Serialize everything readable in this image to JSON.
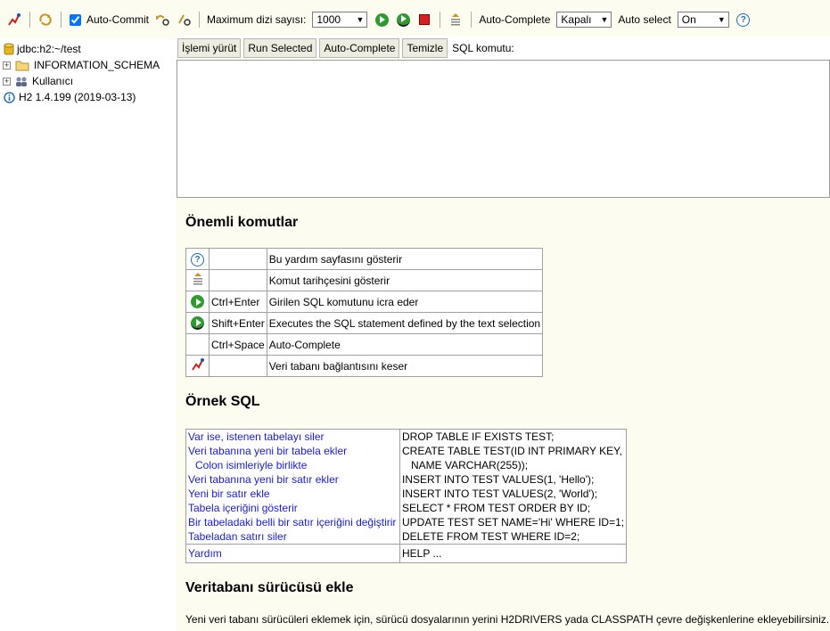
{
  "toolbar": {
    "disconnect_icon": "disconnect-icon",
    "refresh_icon": "refresh-icon",
    "auto_commit_label": "Auto-Commit",
    "auto_commit_checked": true,
    "rollback_icon": "rollback-icon",
    "commit_icon": "commit-icon",
    "max_rows_label": "Maximum dizi sayısı:",
    "max_rows_value": "1000",
    "run_icon": "run-icon",
    "run_selected_icon": "run-selected-icon",
    "stop_icon": "stop-icon",
    "history_icon": "history-icon",
    "auto_complete_label": "Auto-Complete",
    "auto_complete_value": "Kapalı",
    "auto_select_label": "Auto select",
    "auto_select_value": "On",
    "help_icon": "help-icon"
  },
  "tree": {
    "connection": "jdbc:h2:~/test",
    "items": [
      {
        "label": "INFORMATION_SCHEMA",
        "icon": "folder-icon"
      },
      {
        "label": "Kullanıcı",
        "icon": "users-icon"
      }
    ],
    "version": "H2 1.4.199 (2019-03-13)"
  },
  "query": {
    "run_button": "İşlemi yürüt",
    "run_selected_button": "Run Selected",
    "auto_complete_button": "Auto-Complete",
    "clear_button": "Temizle",
    "sql_label": "SQL komutu:",
    "sql_text": ""
  },
  "help": {
    "important_title": "Önemli komutlar",
    "commands": [
      {
        "icon": "help-icon",
        "key": "",
        "desc": "Bu yardım sayfasını gösterir"
      },
      {
        "icon": "history-icon",
        "key": "",
        "desc": "Komut tarihçesini gösterir"
      },
      {
        "icon": "run-icon",
        "key": "Ctrl+Enter",
        "desc": "Girilen SQL komutunu icra eder"
      },
      {
        "icon": "run-selected-icon",
        "key": "Shift+Enter",
        "desc": "Executes the SQL statement defined by the text selection"
      },
      {
        "icon": "",
        "key": "Ctrl+Space",
        "desc": "Auto-Complete"
      },
      {
        "icon": "disconnect-icon",
        "key": "",
        "desc": "Veri tabanı bağlantısını keser"
      }
    ],
    "sample_title": "Örnek SQL",
    "samples": {
      "links": [
        "Var ise, istenen tabelayı siler",
        "Veri tabanına yeni bir tabela ekler",
        "Colon isimleriyle birlikte",
        "Veri tabanına yeni bir satır ekler",
        "Yeni bir satır ekle",
        "Tabela içeriğini gösterir",
        "Bir tabeladaki belli bir satır içeriğini değiştirir",
        "Tabeladan satırı siler"
      ],
      "sql": [
        "DROP TABLE IF EXISTS TEST;",
        "CREATE TABLE TEST(ID INT PRIMARY KEY,",
        "NAME VARCHAR(255));",
        "INSERT INTO TEST VALUES(1, 'Hello');",
        "INSERT INTO TEST VALUES(2, 'World');",
        "SELECT * FROM TEST ORDER BY ID;",
        "UPDATE TEST SET NAME='Hi' WHERE ID=1;",
        "DELETE FROM TEST WHERE ID=2;"
      ],
      "help_link": "Yardım",
      "help_sql": "HELP ..."
    },
    "driver_title": "Veritabanı sürücüsü ekle",
    "driver_text": "Yeni veri tabanı sürücüleri eklemek için, sürücü dosyalarının yerini H2DRIVERS yada CLASSPATH çevre değişkenlerine ekleyebilirsiniz."
  },
  "colors": {
    "background": "#fcfcf0",
    "link": "#1a1adc",
    "run_green": "#2f9a2f",
    "stop_red": "#d42020"
  }
}
